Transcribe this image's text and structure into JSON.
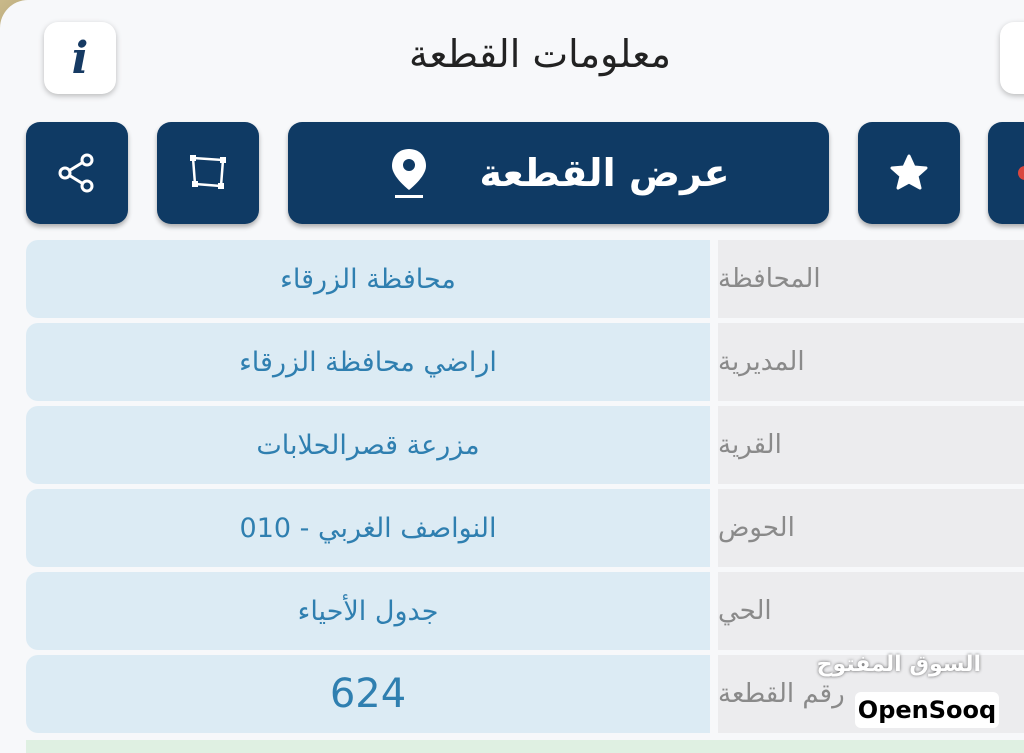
{
  "header": {
    "title": "معلومات القطعة",
    "info_icon_glyph": "i"
  },
  "toolbar": {
    "share_icon": "share-icon",
    "polygon_icon": "polygon-icon",
    "show_parcel_label": "عرض القطعة",
    "location_icon": "location-pin-icon",
    "favorite_icon": "star-icon"
  },
  "parcel": {
    "rows": [
      {
        "label": "المحافظة",
        "value": "محافظة الزرقاء"
      },
      {
        "label": "المديرية",
        "value": "اراضي محافظة الزرقاء"
      },
      {
        "label": "القرية",
        "value": "مزرعة قصرالحلابات"
      },
      {
        "label": "الحوض",
        "value": "النواصف الغربي - 010"
      },
      {
        "label": "الحي",
        "value": "جدول الأحياء"
      },
      {
        "label": "رقم القطعة",
        "value": "624"
      }
    ]
  },
  "watermark": {
    "arabic": "السوق المفتوح",
    "english": "OpenSooq"
  },
  "colors": {
    "primary": "#0f3a64",
    "value_bg": "#dcebf4",
    "value_text": "#2f7fb0",
    "label_bg": "#ececee",
    "label_text": "#8a8a8a"
  }
}
